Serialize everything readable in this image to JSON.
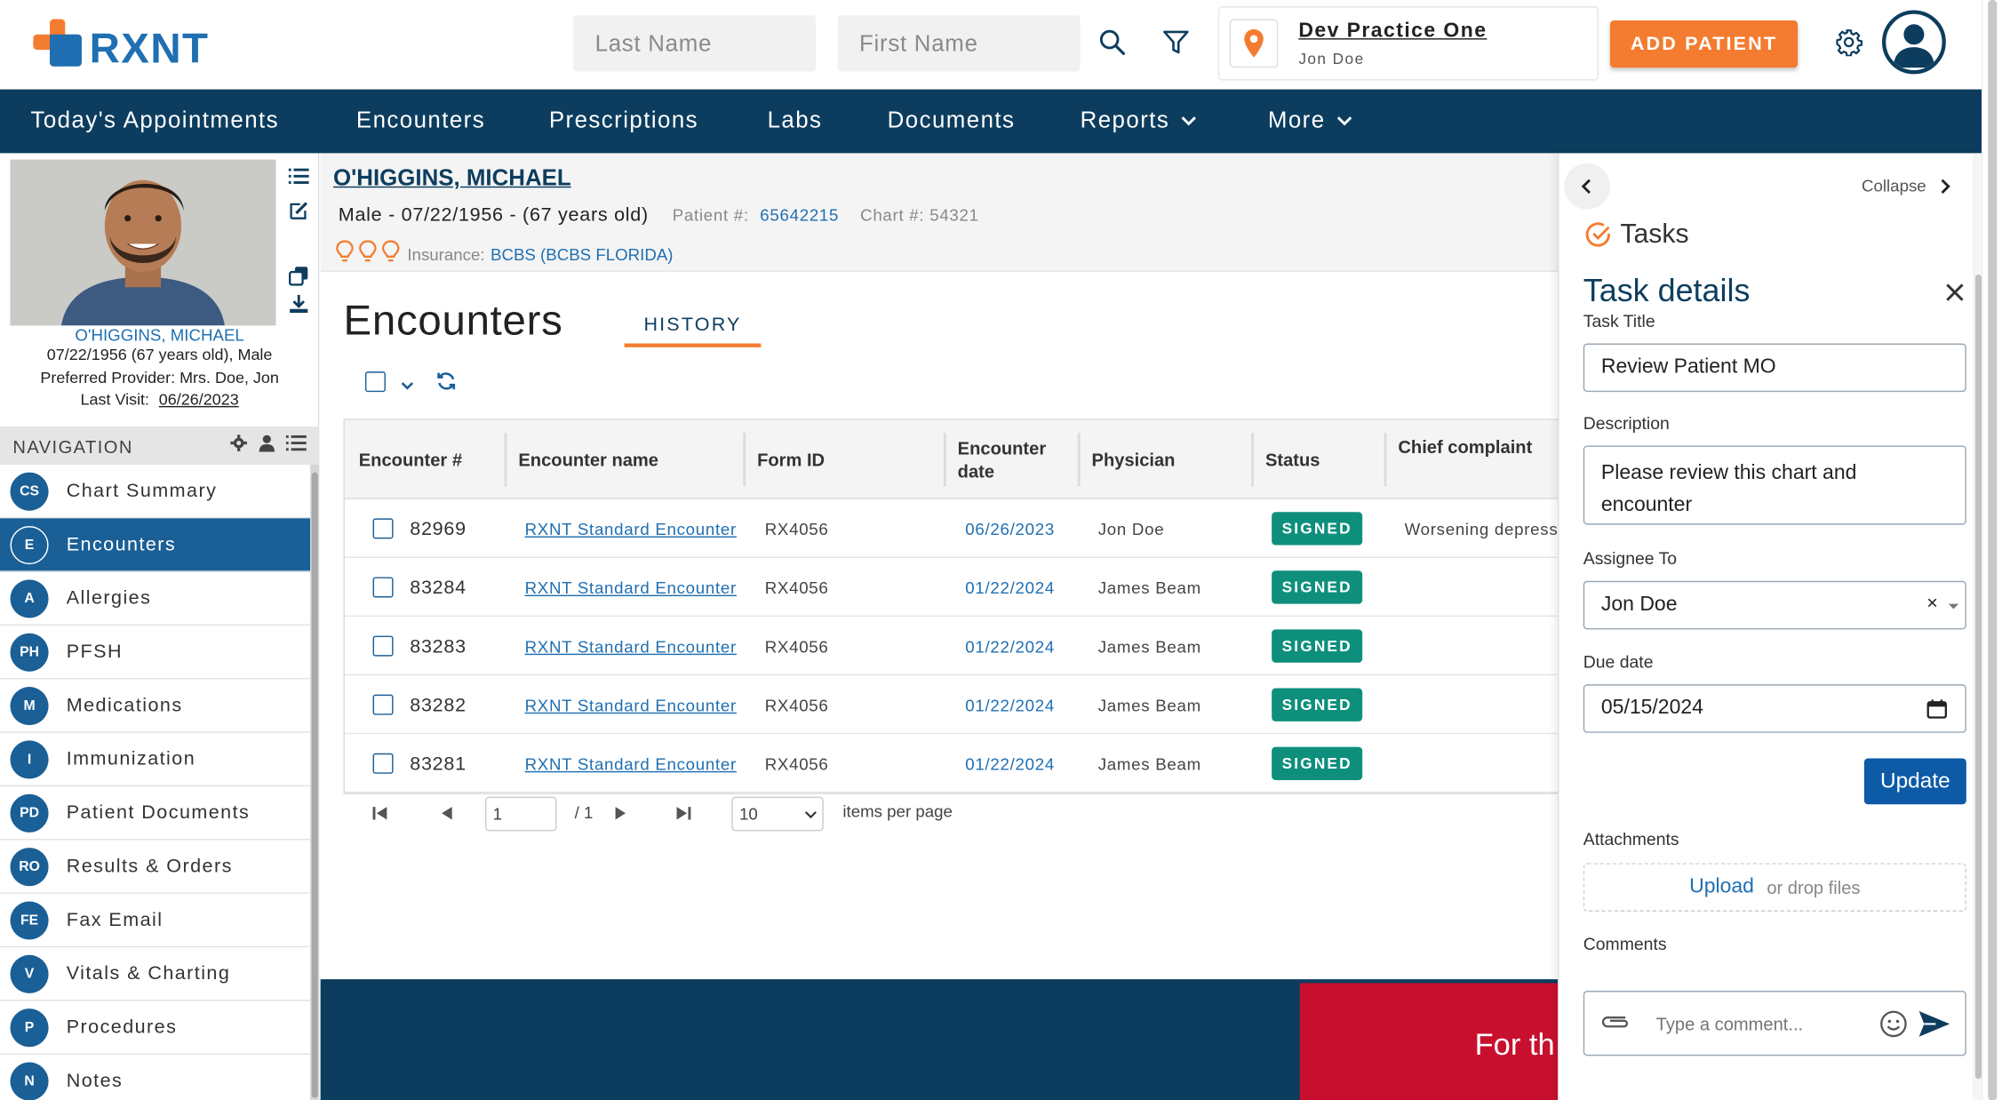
{
  "header": {
    "logo_text": "RXNT",
    "last_name_placeholder": "Last Name",
    "first_name_placeholder": "First Name",
    "practice_name": "Dev Practice One",
    "practice_user": "Jon Doe",
    "add_patient_label": "ADD PATIENT"
  },
  "nav": {
    "items": [
      {
        "label": "Today's Appointments"
      },
      {
        "label": "Encounters"
      },
      {
        "label": "Prescriptions"
      },
      {
        "label": "Labs"
      },
      {
        "label": "Documents"
      },
      {
        "label": "Reports"
      },
      {
        "label": "More"
      }
    ]
  },
  "patient": {
    "name": "O'HIGGINS, MICHAEL",
    "header_name": "O'HIGGINS, MICHAEL",
    "demographics": "Male - 07/22/1956 - (67 years old)",
    "dob_line": "07/22/1956 (67 years old), Male",
    "preferred_provider": "Preferred Provider: Mrs. Doe, Jon",
    "last_visit_label": "Last Visit:",
    "last_visit": "06/26/2023",
    "patient_num_label": "Patient #:",
    "patient_num": "65642215",
    "chart_label": "Chart #: 54321",
    "insurance_label": "Insurance:",
    "insurance": "BCBS (BCBS FLORIDA)"
  },
  "sidebar": {
    "heading": "NAVIGATION",
    "items": [
      {
        "abbr": "CS",
        "label": "Chart Summary"
      },
      {
        "abbr": "E",
        "label": "Encounters"
      },
      {
        "abbr": "A",
        "label": "Allergies"
      },
      {
        "abbr": "PH",
        "label": "PFSH"
      },
      {
        "abbr": "M",
        "label": "Medications"
      },
      {
        "abbr": "I",
        "label": "Immunization"
      },
      {
        "abbr": "PD",
        "label": "Patient Documents"
      },
      {
        "abbr": "RO",
        "label": "Results & Orders"
      },
      {
        "abbr": "FE",
        "label": "Fax Email"
      },
      {
        "abbr": "V",
        "label": "Vitals & Charting"
      },
      {
        "abbr": "P",
        "label": "Procedures"
      },
      {
        "abbr": "N",
        "label": "Notes"
      }
    ]
  },
  "encounters": {
    "title": "Encounters",
    "history_tab": "HISTORY",
    "columns": [
      "Encounter #",
      "Encounter name",
      "Form ID",
      "Encounter date",
      "Physician",
      "Status",
      "Chief complaint"
    ],
    "rows": [
      {
        "num": "82969",
        "name": "RXNT Standard Encounter",
        "form": "RX4056",
        "date": "06/26/2023",
        "physician": "Jon Doe",
        "status": "SIGNED",
        "complaint": "Worsening depress"
      },
      {
        "num": "83284",
        "name": "RXNT Standard Encounter",
        "form": "RX4056",
        "date": "01/22/2024",
        "physician": "James Beam",
        "status": "SIGNED",
        "complaint": ""
      },
      {
        "num": "83283",
        "name": "RXNT Standard Encounter",
        "form": "RX4056",
        "date": "01/22/2024",
        "physician": "James Beam",
        "status": "SIGNED",
        "complaint": ""
      },
      {
        "num": "83282",
        "name": "RXNT Standard Encounter",
        "form": "RX4056",
        "date": "01/22/2024",
        "physician": "James Beam",
        "status": "SIGNED",
        "complaint": ""
      },
      {
        "num": "83281",
        "name": "RXNT Standard Encounter",
        "form": "RX4056",
        "date": "01/22/2024",
        "physician": "James Beam",
        "status": "SIGNED",
        "complaint": ""
      }
    ],
    "pager": {
      "page": "1",
      "of": "/ 1",
      "per_page": "10",
      "per_page_label": "items per page"
    }
  },
  "banner": {
    "text": "For th"
  },
  "tasks": {
    "collapse_label": "Collapse",
    "heading": "Tasks",
    "details_heading": "Task details",
    "title_label": "Task Title",
    "title_value": "Review Patient MO",
    "description_label": "Description",
    "description_value": "Please review this chart and encounter",
    "assignee_label": "Assignee To",
    "assignee_value": "Jon Doe",
    "due_label": "Due date",
    "due_value": "05/15/2024",
    "update_label": "Update",
    "attachments_label": "Attachments",
    "upload_label": "Upload",
    "drop_label": "or drop files",
    "comments_label": "Comments",
    "comment_placeholder": "Type a comment..."
  },
  "colors": {
    "navy": "#0d3d5e",
    "orange": "#f47c30",
    "blue": "#1f6fb2",
    "signed": "#0e8f7c",
    "banner_red": "#c8102e"
  }
}
